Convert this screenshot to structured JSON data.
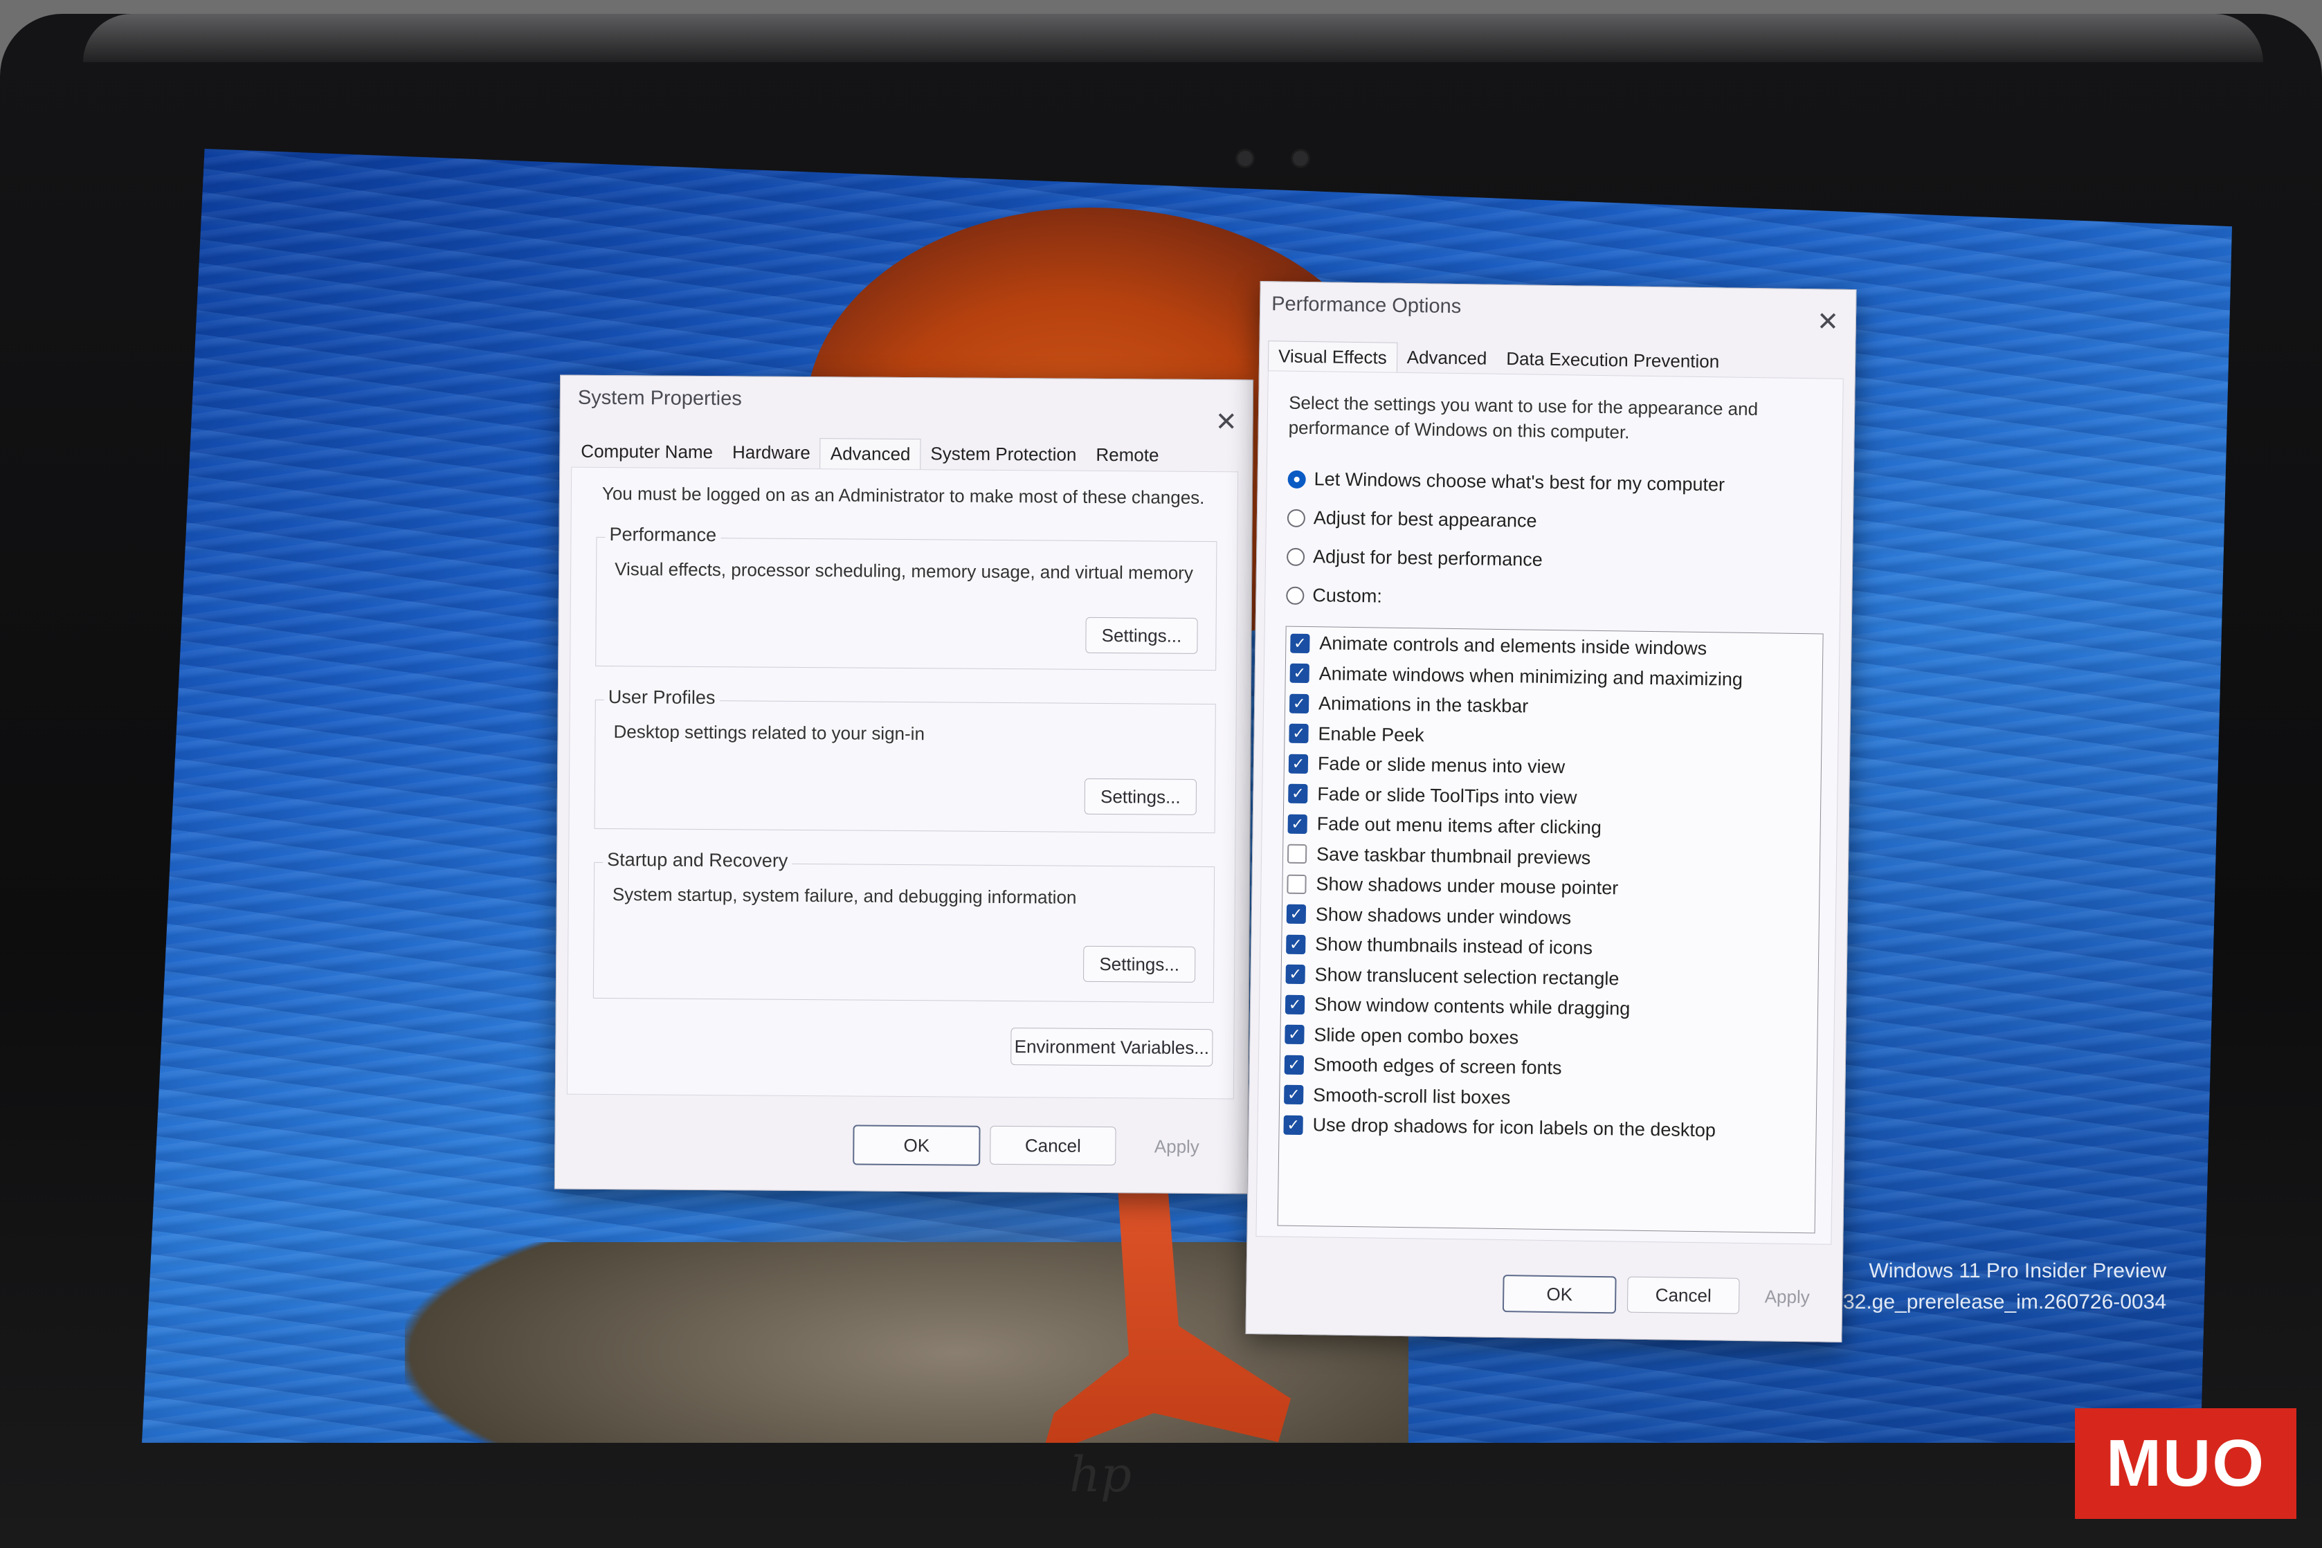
{
  "system_properties": {
    "title": "System Properties",
    "tabs": [
      "Computer Name",
      "Hardware",
      "Advanced",
      "System Protection",
      "Remote"
    ],
    "active_tab": "Advanced",
    "admin_note": "You must be logged on as an Administrator to make most of these changes.",
    "performance": {
      "label": "Performance",
      "description": "Visual effects, processor scheduling, memory usage, and virtual memory",
      "button": "Settings..."
    },
    "user_profiles": {
      "label": "User Profiles",
      "description": "Desktop settings related to your sign-in",
      "button": "Settings..."
    },
    "startup_recovery": {
      "label": "Startup and Recovery",
      "description": "System startup, system failure, and debugging information",
      "button": "Settings..."
    },
    "env_button": "Environment Variables...",
    "ok": "OK",
    "cancel": "Cancel",
    "apply": "Apply"
  },
  "performance_options": {
    "title": "Performance Options",
    "tabs": [
      "Visual Effects",
      "Advanced",
      "Data Execution Prevention"
    ],
    "active_tab": "Visual Effects",
    "intro_line1": "Select the settings you want to use for the appearance and",
    "intro_line2": "performance of Windows on this computer.",
    "radios": [
      {
        "label": "Let Windows choose what's best for my computer",
        "selected": true
      },
      {
        "label": "Adjust for best appearance",
        "selected": false
      },
      {
        "label": "Adjust for best performance",
        "selected": false
      },
      {
        "label": "Custom:",
        "selected": false
      }
    ],
    "effects": [
      {
        "label": "Animate controls and elements inside windows",
        "checked": true
      },
      {
        "label": "Animate windows when minimizing and maximizing",
        "checked": true
      },
      {
        "label": "Animations in the taskbar",
        "checked": true
      },
      {
        "label": "Enable Peek",
        "checked": true
      },
      {
        "label": "Fade or slide menus into view",
        "checked": true
      },
      {
        "label": "Fade or slide ToolTips into view",
        "checked": true
      },
      {
        "label": "Fade out menu items after clicking",
        "checked": true
      },
      {
        "label": "Save taskbar thumbnail previews",
        "checked": false
      },
      {
        "label": "Show shadows under mouse pointer",
        "checked": false
      },
      {
        "label": "Show shadows under windows",
        "checked": true
      },
      {
        "label": "Show thumbnails instead of icons",
        "checked": true
      },
      {
        "label": "Show translucent selection rectangle",
        "checked": true
      },
      {
        "label": "Show window contents while dragging",
        "checked": true
      },
      {
        "label": "Slide open combo boxes",
        "checked": true
      },
      {
        "label": "Smooth edges of screen fonts",
        "checked": true
      },
      {
        "label": "Smooth-scroll list boxes",
        "checked": true
      },
      {
        "label": "Use drop shadows for icon labels on the desktop",
        "checked": true
      }
    ],
    "ok": "OK",
    "cancel": "Cancel",
    "apply": "Apply"
  },
  "desktop_watermark": {
    "line1": "Windows 11 Pro Insider Preview",
    "line2": "Evaluation copy. Build 26300.9032.ge_prerelease_im.260726-0034"
  },
  "icons": {
    "close": "close-icon",
    "check": "checkmark-icon"
  },
  "colors": {
    "accent": "#1a4fa3",
    "dialog_bg": "#f3f1f6",
    "badge": "#d7271c"
  },
  "badge": {
    "text": "MUO"
  }
}
